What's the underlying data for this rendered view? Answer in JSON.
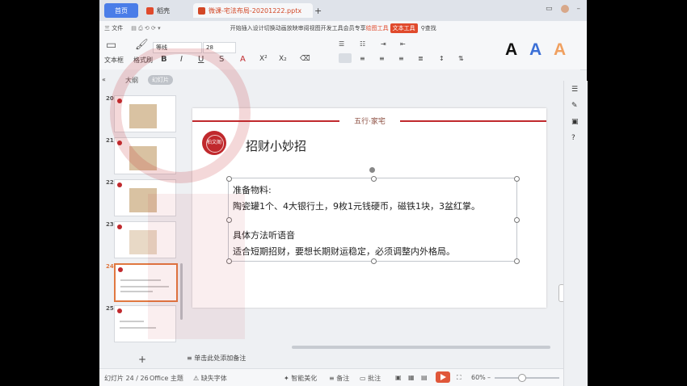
{
  "window": {
    "tabs": [
      {
        "label": "首页"
      },
      {
        "label": "稻壳"
      },
      {
        "label": "微课-宅法布局-20201222.pptx"
      }
    ]
  },
  "menubar": {
    "file": "三 文件",
    "items": "开始插入设计切换动画放映审阅视图",
    "dev": "开发工具",
    "vip": "会员专享",
    "drawing": "绘图工具",
    "text_tools": "文本工具",
    "search": "查找"
  },
  "ribbon": {
    "textbox_label": "文本框",
    "format_brush": "格式刷",
    "font_name": "等线",
    "font_size": "28",
    "style_A": "A"
  },
  "thumb_panel": {
    "header": "大纲",
    "pill": "幻灯片",
    "slides": [
      {
        "num": "20"
      },
      {
        "num": "21"
      },
      {
        "num": "22"
      },
      {
        "num": "23"
      },
      {
        "num": "24"
      },
      {
        "num": "25"
      }
    ],
    "add": "+"
  },
  "slide": {
    "header": "五行·家宅",
    "seal_text": "柏文阁",
    "title": "招财小妙招",
    "lines": [
      "准备物料:",
      "陶瓷罐1个、4大银行土，9枚1元钱硬币，磁铁1块，3盆红掌。",
      "",
      "具体方法听语音",
      "适合短期招财，要想长期财运稳定，必须调整内外格局。"
    ]
  },
  "notes_placeholder": "单击此处添加备注",
  "status": {
    "slide_count": "幻灯片 24 / 26",
    "theme": "Office 主题",
    "missing_font": "缺失字体",
    "beautify": "智能美化",
    "notes": "备注",
    "comments": "批注",
    "zoom": "60%"
  },
  "colors": {
    "accent_red": "#c0292d",
    "menu_active": "#e04a2c",
    "home_tab": "#4a7de8"
  }
}
